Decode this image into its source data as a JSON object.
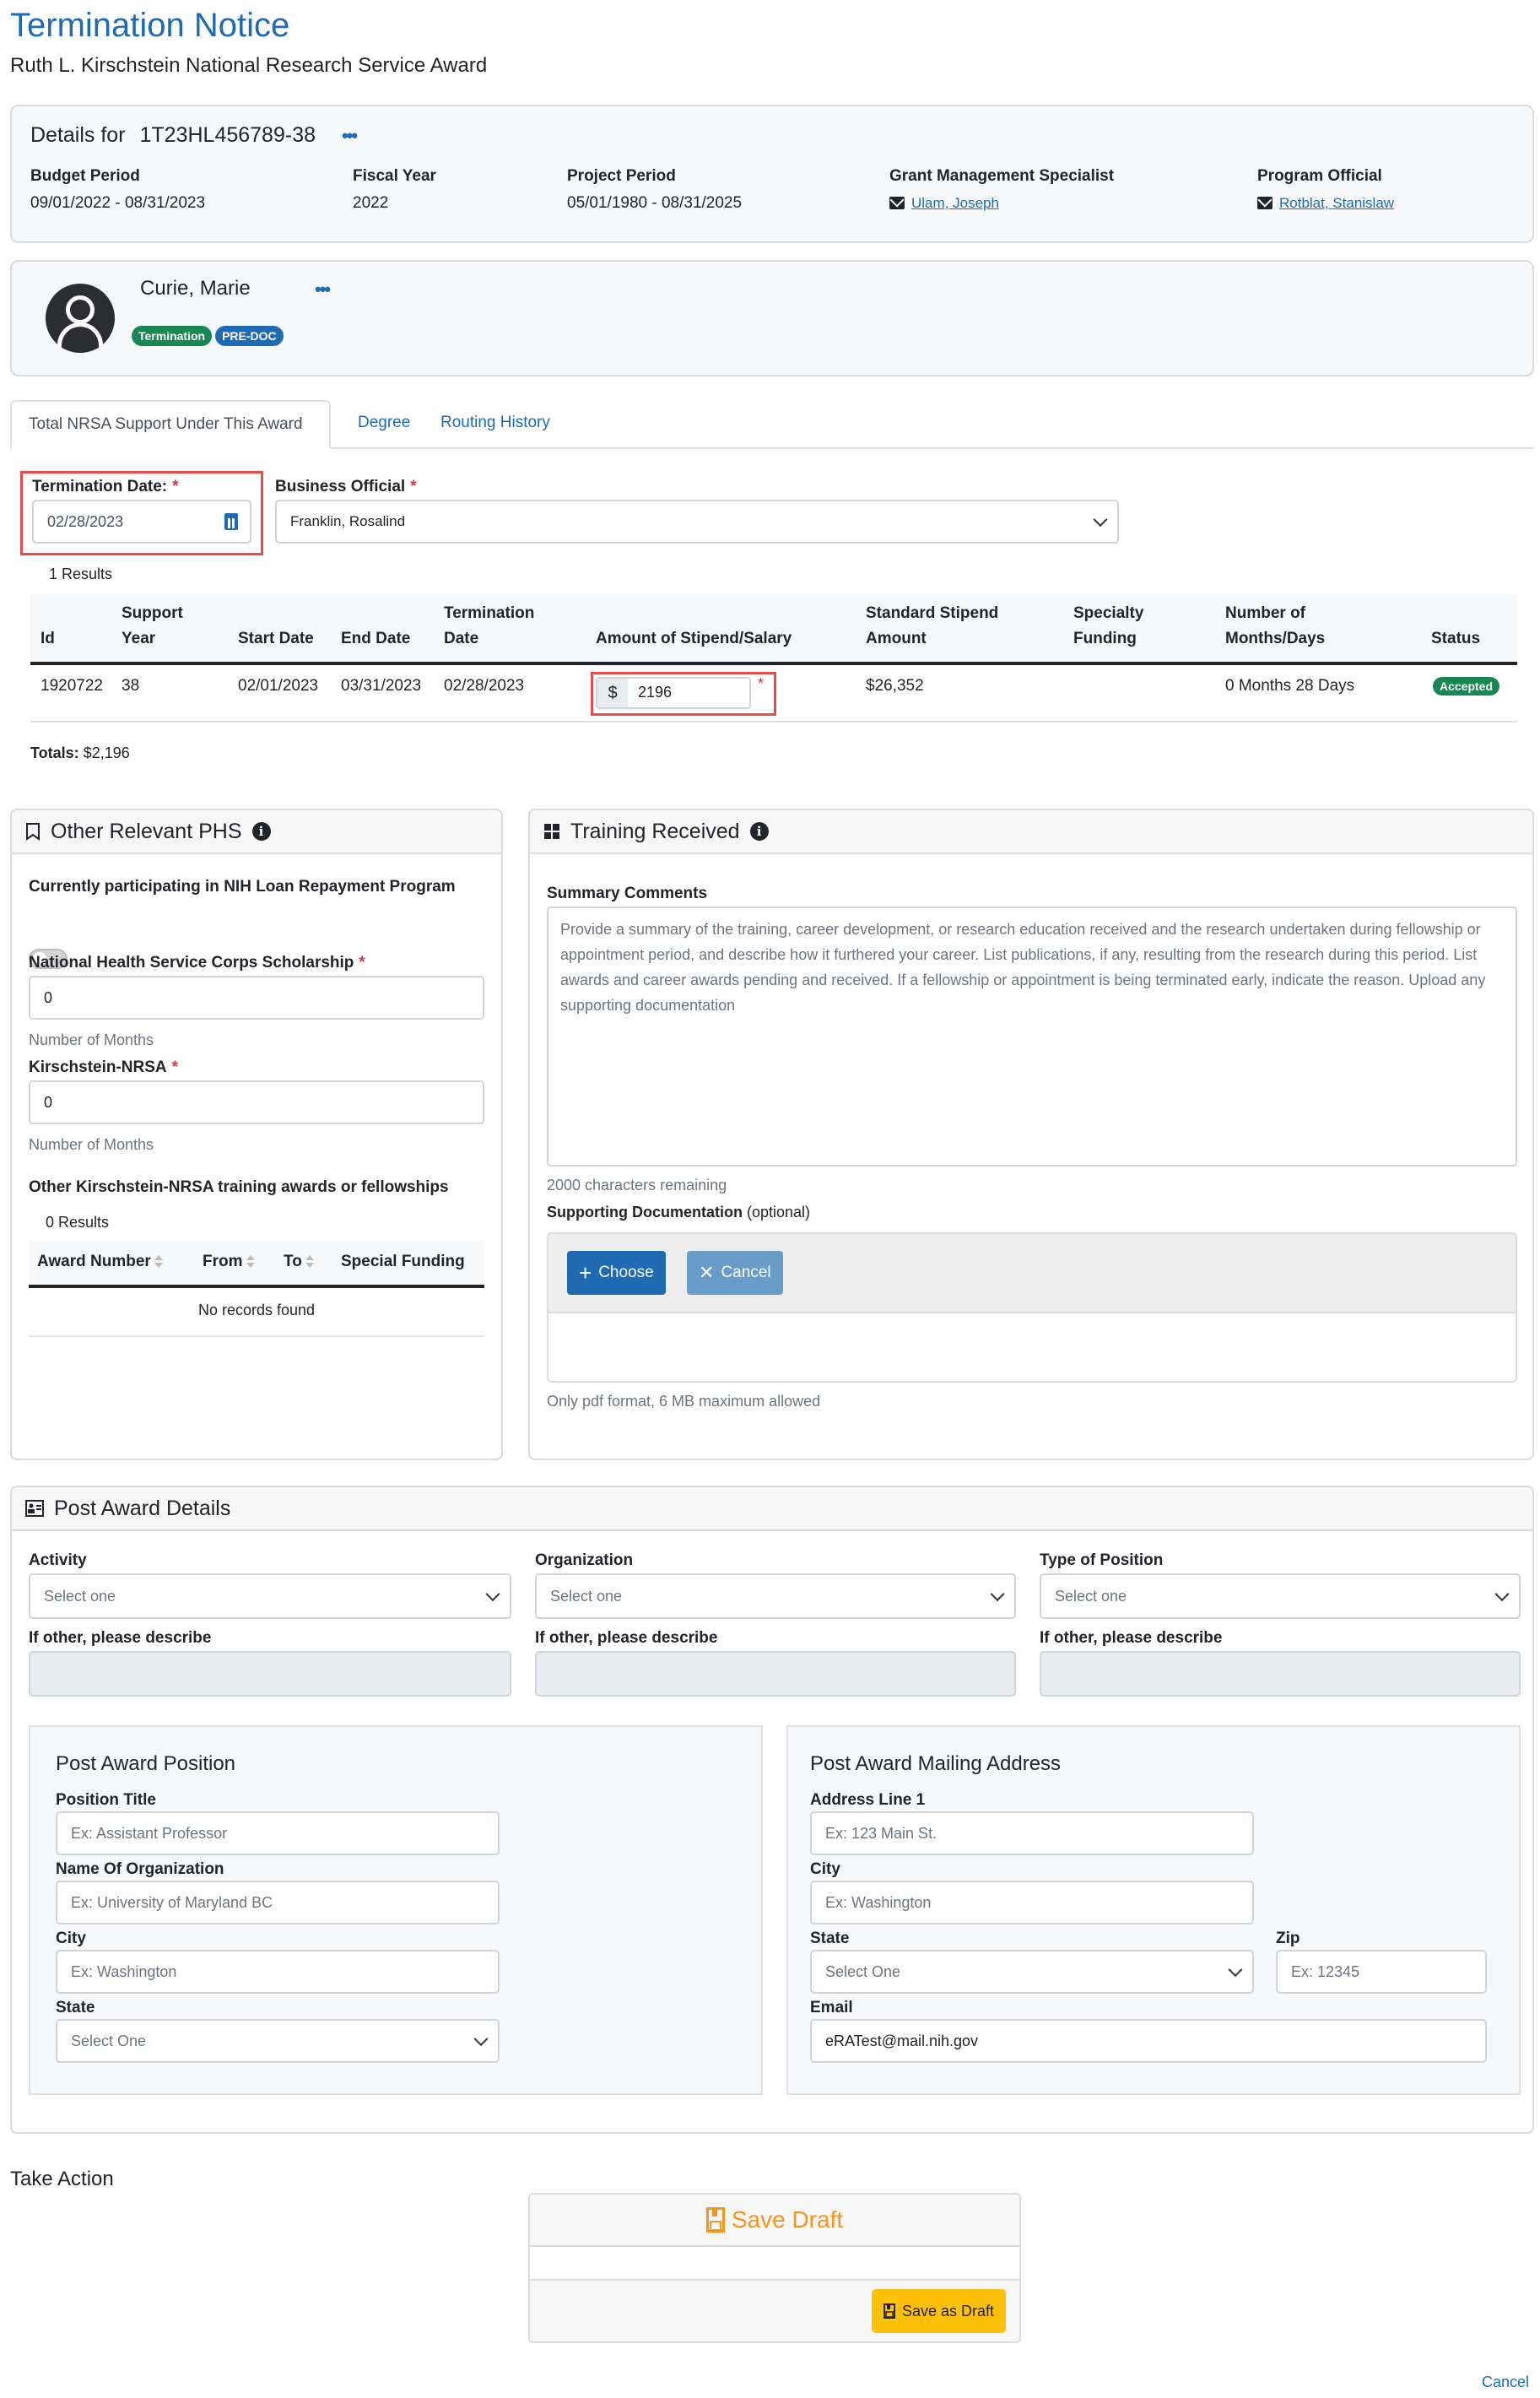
{
  "header": {
    "title": "Termination Notice",
    "subtitle": "Ruth L. Kirschstein National Research Service Award"
  },
  "details": {
    "heading_prefix": "Details for",
    "award_number": "1T23HL456789-38",
    "more_label": "•••",
    "budget_period_label": "Budget Period",
    "budget_period": "09/01/2022 - 08/31/2023",
    "fiscal_year_label": "Fiscal Year",
    "fiscal_year": "2022",
    "project_period_label": "Project Period",
    "project_period": "05/01/1980 - 08/31/2025",
    "gms_label": "Grant Management Specialist",
    "gms_name": "Ulam, Joseph",
    "po_label": "Program Official",
    "po_name": "Rotblat, Stanislaw"
  },
  "person": {
    "name": "Curie, Marie",
    "more_label": "•••",
    "badges": [
      "Termination",
      "PRE-DOC"
    ],
    "badge_colors": [
      "#198754",
      "#1f6bb3"
    ]
  },
  "tabs": [
    {
      "label": "Total NRSA Support Under This Award",
      "active": true
    },
    {
      "label": "Degree",
      "active": false
    },
    {
      "label": "Routing History",
      "active": false
    }
  ],
  "form": {
    "termination_date_label": "Termination Date:",
    "termination_date": "02/28/2023",
    "business_official_label": "Business Official",
    "business_official": "Franklin, Rosalind",
    "required_mark": "*"
  },
  "results": {
    "count_label": "1 Results",
    "columns": [
      [
        "Id"
      ],
      [
        "Support",
        "Year"
      ],
      [
        "Start Date"
      ],
      [
        "End Date"
      ],
      [
        "Termination",
        "Date"
      ],
      [
        "Amount of Stipend/Salary"
      ],
      [
        "Standard Stipend",
        "Amount"
      ],
      [
        "Specialty",
        "Funding"
      ],
      [
        "Number of",
        "Months/Days"
      ],
      [
        "Status"
      ]
    ],
    "rows": [
      {
        "id": "1920722",
        "support_year": "38",
        "start_date": "02/01/2023",
        "end_date": "03/31/2023",
        "termination_date": "02/28/2023",
        "currency_symbol": "$",
        "amount": "2196",
        "standard_stipend": "$26,352",
        "specialty_funding": "",
        "months_days": "0 Months 28 Days",
        "status": "Accepted"
      }
    ],
    "totals_label": "Totals:",
    "totals_value": "$2,196"
  },
  "phs": {
    "title": "Other Relevant PHS",
    "loan_label": "Currently participating in NIH Loan Repayment Program",
    "loan_enabled": false,
    "nhsc_label": "National Health Service Corps Scholarship",
    "nhsc_value": "0",
    "nhsc_help": "Number of Months",
    "nrsa_label": "Kirschstein-NRSA",
    "nrsa_value": "0",
    "nrsa_help": "Number of Months",
    "other_label": "Other Kirschstein-NRSA training awards or fellowships",
    "other_count": "0 Results",
    "other_columns": [
      "Award Number",
      "From",
      "To",
      "Special Funding"
    ],
    "other_empty": "No records found"
  },
  "training": {
    "title": "Training Received",
    "summary_label": "Summary Comments",
    "summary_placeholder": "Provide a summary of the training, career development, or research education received and the research undertaken during fellowship or appointment period, and describe how it furthered your career. List publications, if any, resulting from the research during this period. List awards and career awards pending and received. If a fellowship or appointment is being terminated early, indicate the reason. Upload any supporting documentation",
    "chars_remaining": "2000 characters remaining",
    "doc_label": "Supporting Documentation",
    "doc_optional": "(optional)",
    "choose_label": "Choose",
    "cancel_label": "Cancel",
    "doc_help": "Only pdf format, 6 MB maximum allowed"
  },
  "post_award": {
    "title": "Post Award Details",
    "activity_label": "Activity",
    "activity_value": "Select one",
    "organization_label": "Organization",
    "organization_value": "Select one",
    "position_type_label": "Type of Position",
    "position_type_value": "Select one",
    "other_label": "If other, please describe",
    "position": {
      "title": "Post Award Position",
      "position_title_label": "Position Title",
      "position_title_placeholder": "Ex: Assistant Professor",
      "org_label": "Name Of Organization",
      "org_placeholder": "Ex: University of Maryland BC",
      "city_label": "City",
      "city_placeholder": "Ex: Washington",
      "state_label": "State",
      "state_value": "Select One"
    },
    "mailing": {
      "title": "Post Award Mailing Address",
      "address_label": "Address Line 1",
      "address_placeholder": "Ex: 123 Main St.",
      "city_label": "City",
      "city_placeholder": "Ex: Washington",
      "state_label": "State",
      "state_value": "Select One",
      "zip_label": "Zip",
      "zip_placeholder": "Ex: 12345",
      "email_label": "Email",
      "email_value": "eRATest@mail.nih.gov"
    }
  },
  "actions": {
    "title": "Take Action",
    "card_title": "Save Draft",
    "save_button": "Save as Draft",
    "cancel_link": "Cancel",
    "accent_color": "#f7941d",
    "button_color": "#ffc107"
  }
}
